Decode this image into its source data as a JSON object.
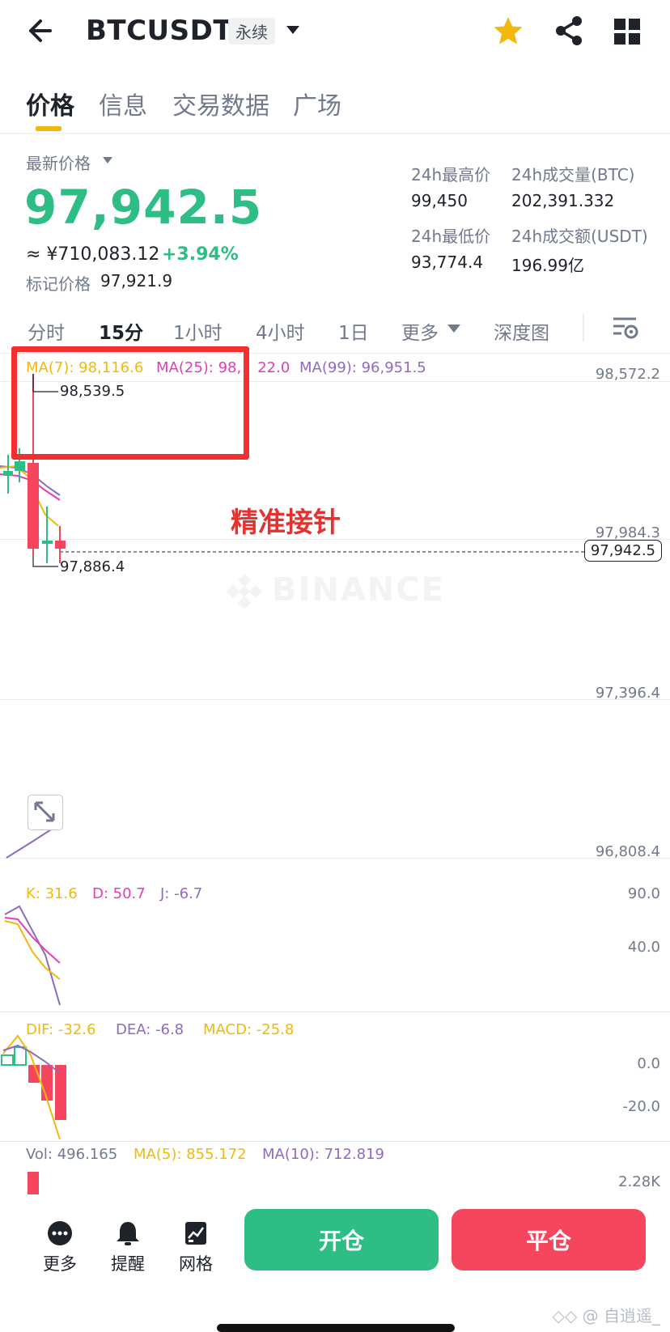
{
  "header": {
    "title": "BTCUSDT",
    "contract_badge": "永续",
    "icons": [
      "back-arrow-icon",
      "caret-down-icon",
      "star-icon",
      "share-icon",
      "grid-icon"
    ],
    "star_color": "#f0b90b"
  },
  "tabs": [
    "价格",
    "信息",
    "交易数据",
    "广场"
  ],
  "active_tab": "价格",
  "price_panel": {
    "latest_label": "最新价格",
    "last_price": "97,942.5",
    "cny_value": "≈ ¥710,083.12",
    "change_pct": "+3.94%",
    "mark_label": "标记价格",
    "mark_value": "97,921.9",
    "up_color": "#2ebd85",
    "stats": {
      "high_label": "24h最高价",
      "high_value": "99,450",
      "vol_btc_label": "24h成交量(BTC)",
      "vol_btc_value": "202,391.332",
      "low_label": "24h最低价",
      "low_value": "93,774.4",
      "vol_usdt_label": "24h成交额(USDT)",
      "vol_usdt_value": "196.99亿"
    }
  },
  "intervals": {
    "items": [
      "分时",
      "15分",
      "1小时",
      "4小时",
      "1日",
      "更多",
      "深度图"
    ],
    "active": "15分"
  },
  "chart": {
    "ma7": "MA(7): 98,116.6",
    "ma25": "MA(25): 98,",
    "ma25_tail": "22.0",
    "ma99": "MA(99): 96,951.5",
    "axis_labels": [
      "98,572.2",
      "97,984.3",
      "97,396.4",
      "96,808.4"
    ],
    "current_price_tag": "97,942.5",
    "high_marker": "98,539.5",
    "low_marker": "97,886.4",
    "annotation": "精准接针",
    "watermark": "BINANCE",
    "colors": {
      "ma7": "#f0b90b",
      "ma25": "#e040b0",
      "ma99": "#8e6bbf",
      "up": "#2ebd85",
      "down": "#f6465d"
    }
  },
  "kdj": {
    "k": "K: 31.6",
    "d": "D: 50.7",
    "j": "J: -6.7",
    "axis": [
      "90.0",
      "40.0"
    ]
  },
  "macd": {
    "dif": "DIF: -32.6",
    "dea": "DEA: -6.8",
    "macd": "MACD: -25.8",
    "axis": [
      "0.0",
      "-20.0"
    ]
  },
  "volume": {
    "vol": "Vol: 496.165",
    "ma5": "MA(5): 855.172",
    "ma10": "MA(10): 712.819",
    "axis": "2.28K"
  },
  "bottom_bar": {
    "more": "更多",
    "alert": "提醒",
    "grid": "网格",
    "open_button": "开仓",
    "close_button": "平仓"
  },
  "credit": "◇◇ @ 自逍遥_"
}
